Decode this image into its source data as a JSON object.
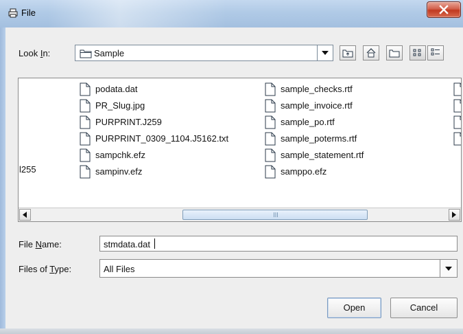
{
  "window": {
    "title": "File",
    "close_label": "close"
  },
  "look_in": {
    "label_pre": "Look ",
    "label_mnemonic": "I",
    "label_post": "n:",
    "value": "Sample",
    "tools": [
      "up-one-level-icon",
      "home-icon",
      "new-folder-icon",
      "list-view-icon",
      "details-view-icon"
    ]
  },
  "file_list": {
    "clipped_left_text": "l255",
    "column1": [
      "podata.dat",
      "PR_Slug.jpg",
      "PURPRINT.J259",
      "PURPRINT_0309_1104.J5162.txt",
      "sampchk.efz",
      "sampinv.efz"
    ],
    "column2": [
      "sample_checks.rtf",
      "sample_invoice.rtf",
      "sample_po.rtf",
      "sample_poterms.rtf",
      "sample_statement.rtf",
      "samppo.efz"
    ],
    "column3_partial_count": 4
  },
  "file_name": {
    "label_pre": "File ",
    "label_mnemonic": "N",
    "label_post": "ame:",
    "value": "stmdata.dat"
  },
  "file_type": {
    "label_pre": "Files of ",
    "label_mnemonic": "T",
    "label_post": "ype:",
    "value": "All Files"
  },
  "buttons": {
    "open": "Open",
    "cancel": "Cancel"
  },
  "colors": {
    "title_bar": "#b0cae6",
    "close_button": "#c0391f",
    "panel_bg": "#eeeeee",
    "scroll_thumb": "#cddff3"
  }
}
